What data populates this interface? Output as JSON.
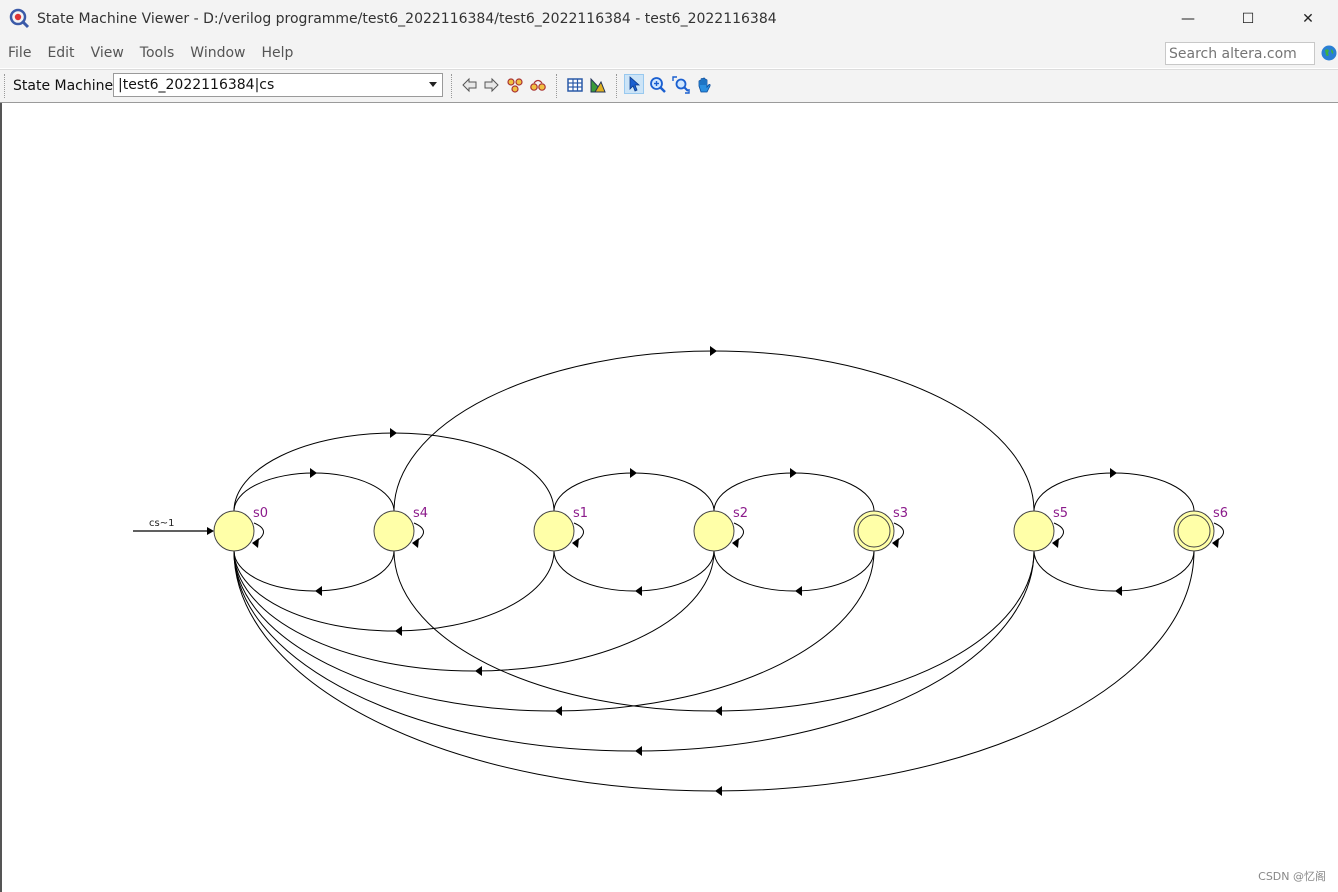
{
  "window": {
    "title": "State Machine Viewer - D:/verilog programme/test6_2022116384/test6_2022116384 - test6_2022116384",
    "minimize": "—",
    "maximize": "☐",
    "close": "✕"
  },
  "menu": {
    "items": [
      {
        "label": "File"
      },
      {
        "label": "Edit"
      },
      {
        "label": "View"
      },
      {
        "label": "Tools"
      },
      {
        "label": "Window"
      },
      {
        "label": "Help"
      }
    ],
    "search_placeholder": "Search altera.com"
  },
  "toolbar": {
    "state_machine_label": "State Machine:",
    "state_machine_value": "|test6_2022116384|cs",
    "icons": [
      "back-icon",
      "forward-icon",
      "show-states-icon",
      "show-transitions-icon",
      "table-icon",
      "export-icon",
      "pointer-icon",
      "zoom-in-icon",
      "fit-icon",
      "pan-hand-icon"
    ]
  },
  "diagram": {
    "reset_label": "cs~1",
    "states": [
      {
        "name": "s0",
        "final": false
      },
      {
        "name": "s4",
        "final": false
      },
      {
        "name": "s1",
        "final": false
      },
      {
        "name": "s2",
        "final": false
      },
      {
        "name": "s3",
        "final": true
      },
      {
        "name": "s5",
        "final": false
      },
      {
        "name": "s6",
        "final": true
      }
    ],
    "transitions": [
      {
        "from": "s0",
        "to": "s0"
      },
      {
        "from": "s4",
        "to": "s4"
      },
      {
        "from": "s1",
        "to": "s1"
      },
      {
        "from": "s2",
        "to": "s2"
      },
      {
        "from": "s3",
        "to": "s3"
      },
      {
        "from": "s5",
        "to": "s5"
      },
      {
        "from": "s6",
        "to": "s6"
      },
      {
        "from": "s0",
        "to": "s4"
      },
      {
        "from": "s0",
        "to": "s1"
      },
      {
        "from": "s4",
        "to": "s5"
      },
      {
        "from": "s1",
        "to": "s2"
      },
      {
        "from": "s2",
        "to": "s3"
      },
      {
        "from": "s5",
        "to": "s6"
      },
      {
        "from": "s4",
        "to": "s0"
      },
      {
        "from": "s1",
        "to": "s0"
      },
      {
        "from": "s2",
        "to": "s1"
      },
      {
        "from": "s3",
        "to": "s2"
      },
      {
        "from": "s6",
        "to": "s5"
      },
      {
        "from": "s2",
        "to": "s0"
      },
      {
        "from": "s3",
        "to": "s0"
      },
      {
        "from": "s5",
        "to": "s4"
      },
      {
        "from": "s5",
        "to": "s0"
      },
      {
        "from": "s6",
        "to": "s0"
      }
    ],
    "colors": {
      "state_fill": "#ffffa8",
      "state_stroke": "#444444",
      "label": "#8b1a8b",
      "edge": "#000000"
    }
  },
  "watermark": "CSDN @忆阁"
}
